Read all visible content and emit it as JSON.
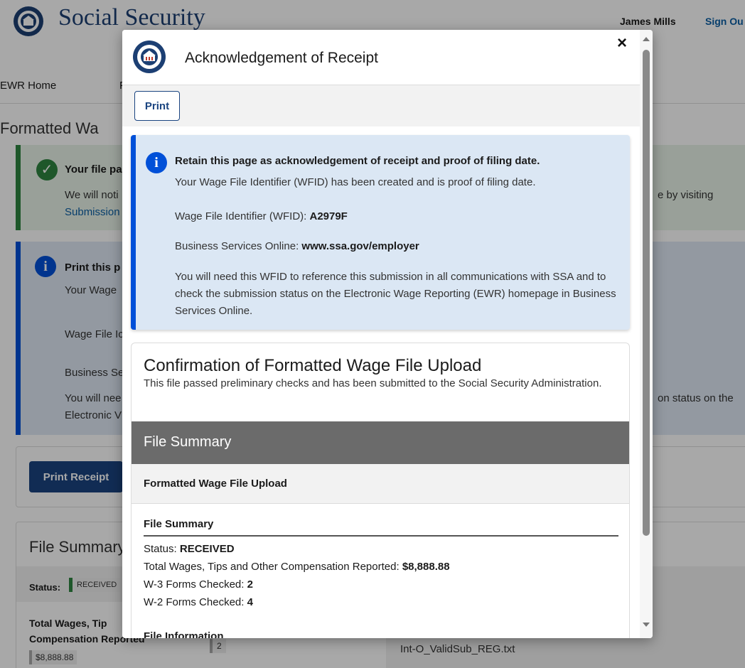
{
  "background": {
    "site_title": "Social Security",
    "user_name": "James Mills",
    "sign_out": "Sign Ou",
    "nav_home": "EWR Home",
    "nav_partial": "F",
    "page_heading": "Formatted Wa",
    "success_alert": {
      "title": "Your file pa",
      "line1": "We will noti",
      "line2": "Submission",
      "right_text": "e by visiting"
    },
    "info_alert": {
      "title": "Print this p",
      "line1": "Your Wage",
      "line2": "Wage File Ic",
      "line3": "Business Se",
      "line4": "You will nee",
      "line5": "Electronic V",
      "right_text": "on status on the"
    },
    "print_receipt_label": "Print Receipt",
    "summary": {
      "heading": "File Summary",
      "status_label": "Status:",
      "status_value": "RECEIVED",
      "total_line1": "Total Wages, Tip",
      "total_line2": "Compensation Reported",
      "total_value": "$8,888.88",
      "count_value": "2",
      "filename": "Int-O_ValidSub_REG.txt"
    }
  },
  "modal": {
    "title": "Acknowledgement of Receipt",
    "close_symbol": "×",
    "print_label": "Print",
    "info": {
      "icon_glyph": "i",
      "heading": "Retain this page as acknowledgement of receipt and proof of filing date.",
      "line1": "Your Wage File Identifier (WFID) has been created and is proof of filing date.",
      "wfid_label": "Wage File Identifier (WFID):",
      "wfid_value": "A2979F",
      "bso_label": "Business Services Online:",
      "bso_value": "www.ssa.gov/employer",
      "paragraph": "You will need this WFID to reference this submission in all communications with SSA and to check the submission status on the Electronic Wage Reporting (EWR) homepage in Business Services Online."
    },
    "confirmation": {
      "title": "Confirmation of Formatted Wage File Upload",
      "subtitle": "This file passed preliminary checks and has been submitted to the Social Security Administration.",
      "file_summary_bar": "File Summary",
      "upload_bar": "Formatted Wage File Upload",
      "section_title": "File Summary",
      "status_label": "Status:",
      "status_value": "RECEIVED",
      "total_label": "Total Wages, Tips and Other Compensation Reported:",
      "total_value": "$8,888.88",
      "w3_label": "W-3 Forms Checked:",
      "w3_value": "2",
      "w2_label": "W-2 Forms Checked:",
      "w2_value": "4",
      "file_info_title": "File Information"
    }
  },
  "colors": {
    "brand_navy": "#1c3f73",
    "link_blue": "#0b5fa5",
    "info_blue": "#0050d8",
    "success_green": "#2e8540",
    "summary_bar": "#6b6b6b"
  }
}
